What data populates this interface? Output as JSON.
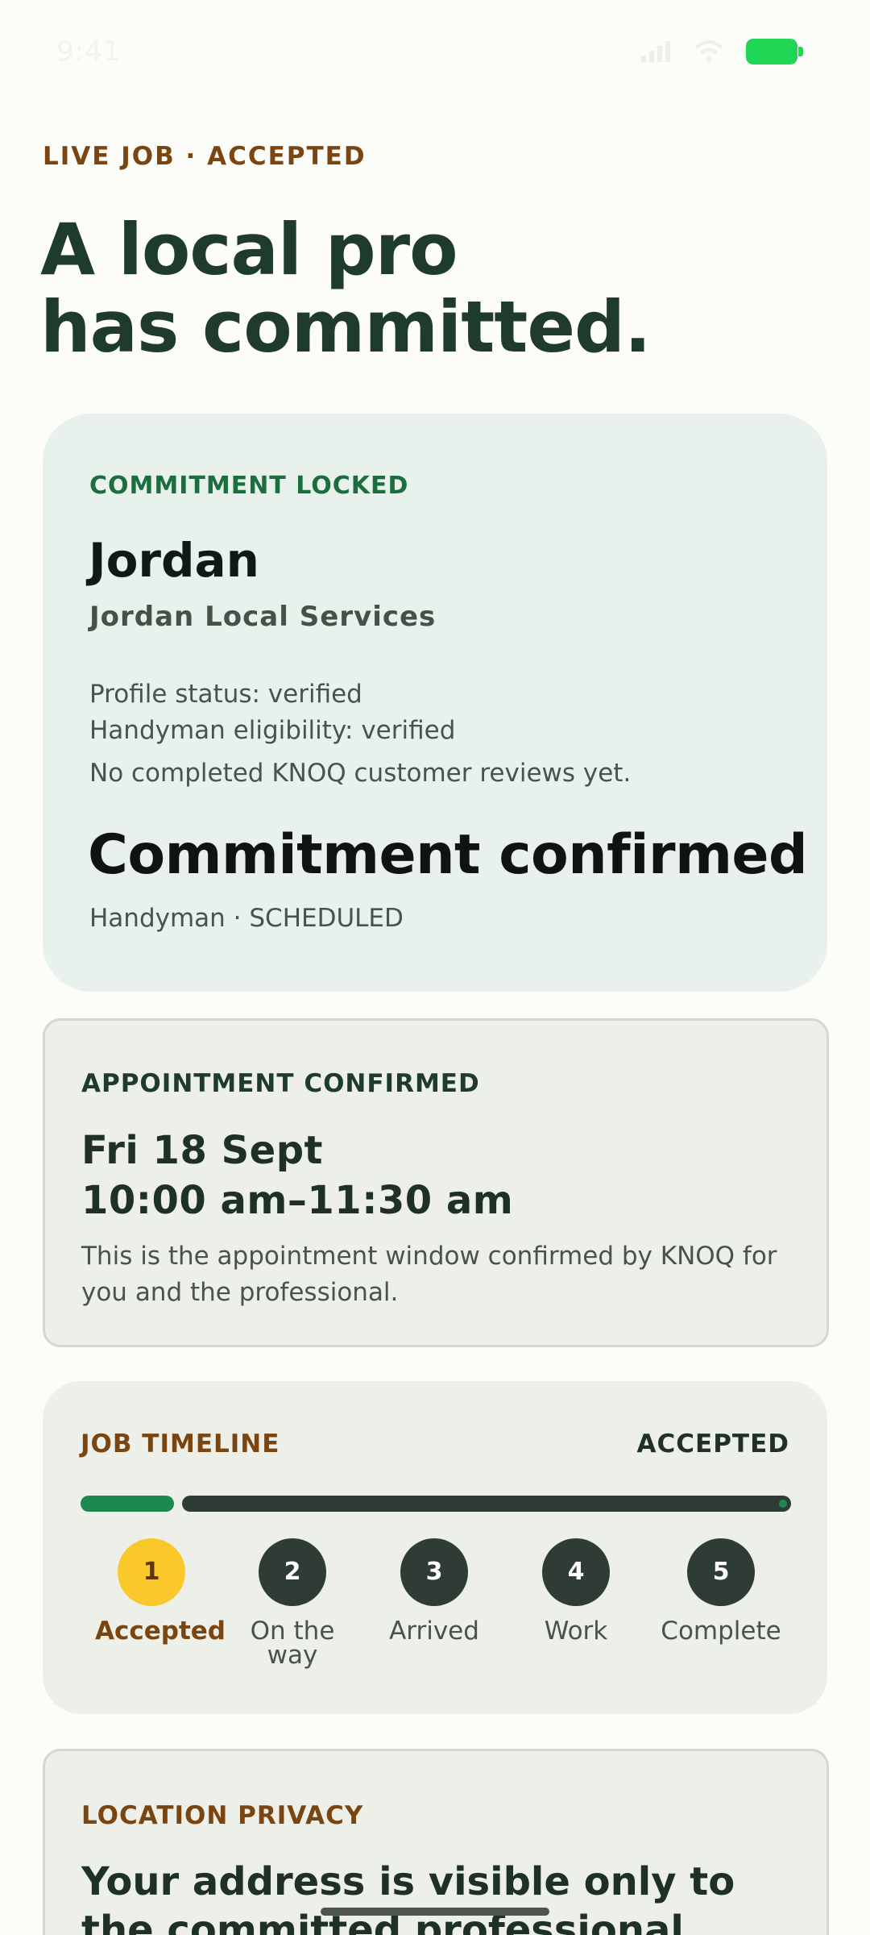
{
  "status_bar": {
    "time": "9:41",
    "signal_icon": "signal-icon",
    "wifi_icon": "wifi-icon",
    "battery_icon": "battery-icon",
    "battery_color": "#1fd655"
  },
  "header": {
    "eyebrow": "LIVE JOB · ACCEPTED",
    "title_line1": "A local pro",
    "title_line2": "has committed."
  },
  "pro_card": {
    "eyebrow": "COMMITMENT LOCKED",
    "name": "Jordan",
    "company": "Jordan Local Services",
    "profile_status": "Profile status: verified",
    "eligibility": "Handyman eligibility: verified",
    "reviews": "No completed KNOQ customer reviews yet.",
    "headline": "Commitment confirmed",
    "subline": "Handyman · SCHEDULED"
  },
  "appointment": {
    "eyebrow": "APPOINTMENT CONFIRMED",
    "date": "Fri 18 Sept",
    "time": "10:00 am–11:30 am",
    "description": "This is the appointment window confirmed by KNOQ for you and the professional."
  },
  "timeline": {
    "title": "JOB TIMELINE",
    "status": "ACCEPTED",
    "progress_fraction": 0.2,
    "steps": [
      {
        "number": "1",
        "label": "Accepted",
        "active": true
      },
      {
        "number": "2",
        "label": "On the way",
        "active": false
      },
      {
        "number": "3",
        "label": "Arrived",
        "active": false
      },
      {
        "number": "4",
        "label": "Work",
        "active": false
      },
      {
        "number": "5",
        "label": "Complete",
        "active": false
      }
    ]
  },
  "privacy": {
    "eyebrow": "LOCATION PRIVACY",
    "title": "Your address is visible only to the committed professional."
  },
  "colors": {
    "brand_green": "#1f3b2d",
    "accent_brown": "#7a4510",
    "progress_green": "#1a8a4f",
    "active_step": "#fbc82c"
  }
}
